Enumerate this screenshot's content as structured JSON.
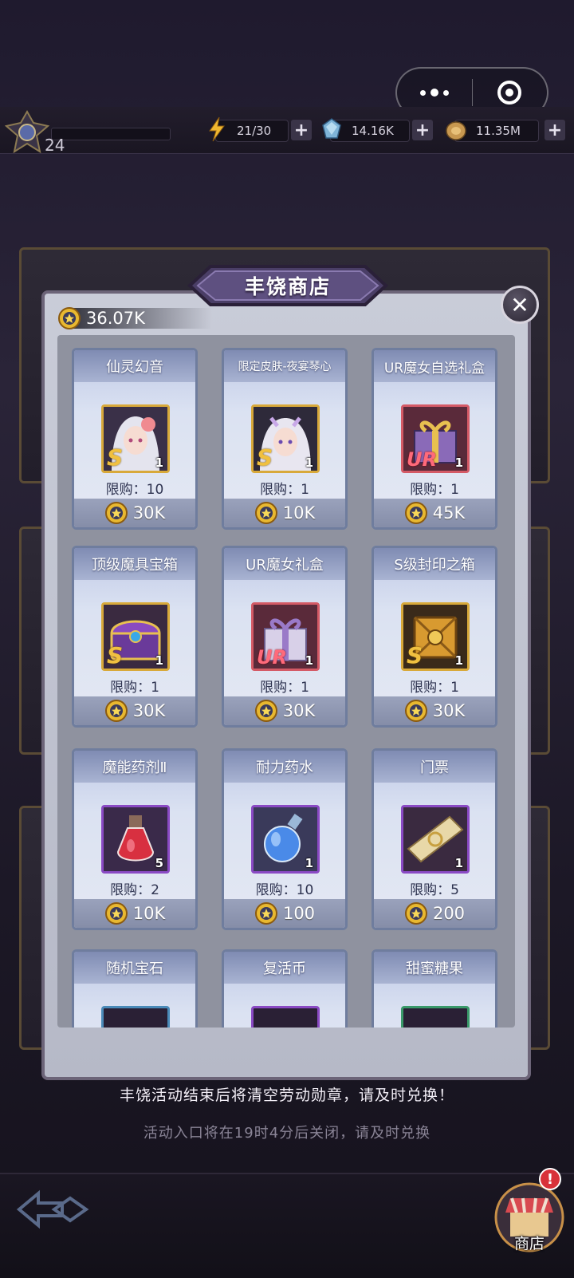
{
  "player": {
    "level": "24"
  },
  "resources": [
    {
      "name": "energy",
      "icon": "lightning-icon",
      "value": "21/30"
    },
    {
      "name": "gems",
      "icon": "crystal-icon",
      "value": "14.16K"
    },
    {
      "name": "gold",
      "icon": "coin-bag-icon",
      "value": "11.35M"
    }
  ],
  "shop": {
    "title": "丰饶商店",
    "balance": "36.07K",
    "items": [
      {
        "title": "仙灵幻音",
        "rank": "S",
        "qty": "1",
        "limit": "限购：10",
        "price": "30K",
        "icon": "elf-girl-portrait-icon",
        "frame": "gold"
      },
      {
        "title": "限定皮肤-夜宴琴心",
        "rank": "S",
        "qty": "1",
        "limit": "限购：1",
        "price": "10K",
        "icon": "elf-girl-skin-portrait-icon",
        "frame": "gold"
      },
      {
        "title": "UR魔女自选礼盒",
        "rank": "UR",
        "qty": "1",
        "limit": "限购：1",
        "price": "45K",
        "icon": "gift-box-icon",
        "frame": "red"
      },
      {
        "title": "顶级魔具宝箱",
        "rank": "S",
        "qty": "1",
        "limit": "限购：1",
        "price": "30K",
        "icon": "treasure-chest-icon",
        "frame": "gold"
      },
      {
        "title": "UR魔女礼盒",
        "rank": "UR",
        "qty": "1",
        "limit": "限购：1",
        "price": "30K",
        "icon": "gift-box-icon",
        "frame": "red"
      },
      {
        "title": "S级封印之箱",
        "rank": "S",
        "qty": "1",
        "limit": "限购：1",
        "price": "30K",
        "icon": "sealed-box-icon",
        "frame": "gold"
      },
      {
        "title": "魔能药剂Ⅱ",
        "rank": "",
        "qty": "5",
        "limit": "限购：2",
        "price": "10K",
        "icon": "red-potion-icon",
        "frame": "purple"
      },
      {
        "title": "耐力药水",
        "rank": "",
        "qty": "1",
        "limit": "限购：10",
        "price": "100",
        "icon": "blue-potion-icon",
        "frame": "purple"
      },
      {
        "title": "门票",
        "rank": "",
        "qty": "1",
        "limit": "限购：5",
        "price": "200",
        "icon": "ticket-icon",
        "frame": "purple"
      },
      {
        "title": "随机宝石",
        "rank": "",
        "qty": "",
        "limit": "",
        "price": "",
        "icon": "gem-icon",
        "frame": "blue"
      },
      {
        "title": "复活币",
        "rank": "",
        "qty": "",
        "limit": "",
        "price": "",
        "icon": "revive-coin-icon",
        "frame": "purple"
      },
      {
        "title": "甜蜜糖果",
        "rank": "",
        "qty": "",
        "limit": "",
        "price": "",
        "icon": "candy-icon",
        "frame": "green"
      }
    ]
  },
  "notices": {
    "line1": "丰饶活动结束后将清空劳动勋章，请及时兑换！",
    "line2": "活动入口将在19时4分后关闭，请及时兑换"
  },
  "bottom": {
    "shop_label": "商店",
    "badge": "!"
  }
}
